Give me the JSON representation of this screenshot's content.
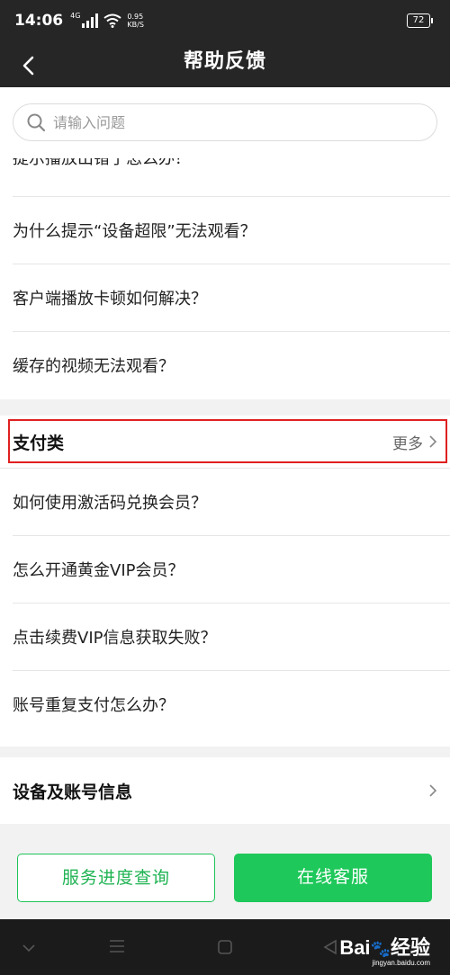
{
  "status_bar": {
    "time": "14:06",
    "network": "4G",
    "speed_value": "0.95",
    "speed_unit": "KB/S",
    "battery": "72"
  },
  "header": {
    "title": "帮助反馈",
    "back_icon": "chevron-left-icon"
  },
  "search": {
    "placeholder": "请输入问题",
    "icon": "search-icon"
  },
  "playback_section": {
    "items": [
      "提示播放出错了怎么办？",
      "为什么提示“设备超限”无法观看？",
      "客户端播放卡顿如何解决？",
      "缓存的视频无法观看？"
    ]
  },
  "payment_section": {
    "title": "支付类",
    "more_label": "更多",
    "items": [
      "如何使用激活码兑换会员？",
      "怎么开通黄金VIP会员？",
      "点击续费VIP信息获取失败？",
      "账号重复支付怎么办？"
    ]
  },
  "device_section": {
    "title": "设备及账号信息"
  },
  "buttons": {
    "service_progress": "服务进度查询",
    "online_support": "在线客服"
  },
  "watermark": {
    "brand": "Bai",
    "brand_suffix": "经验",
    "url": "jingyan.baidu.com"
  },
  "colors": {
    "header_bg": "#262626",
    "accent_green": "#1ec85a",
    "highlight_red": "#e02020"
  }
}
